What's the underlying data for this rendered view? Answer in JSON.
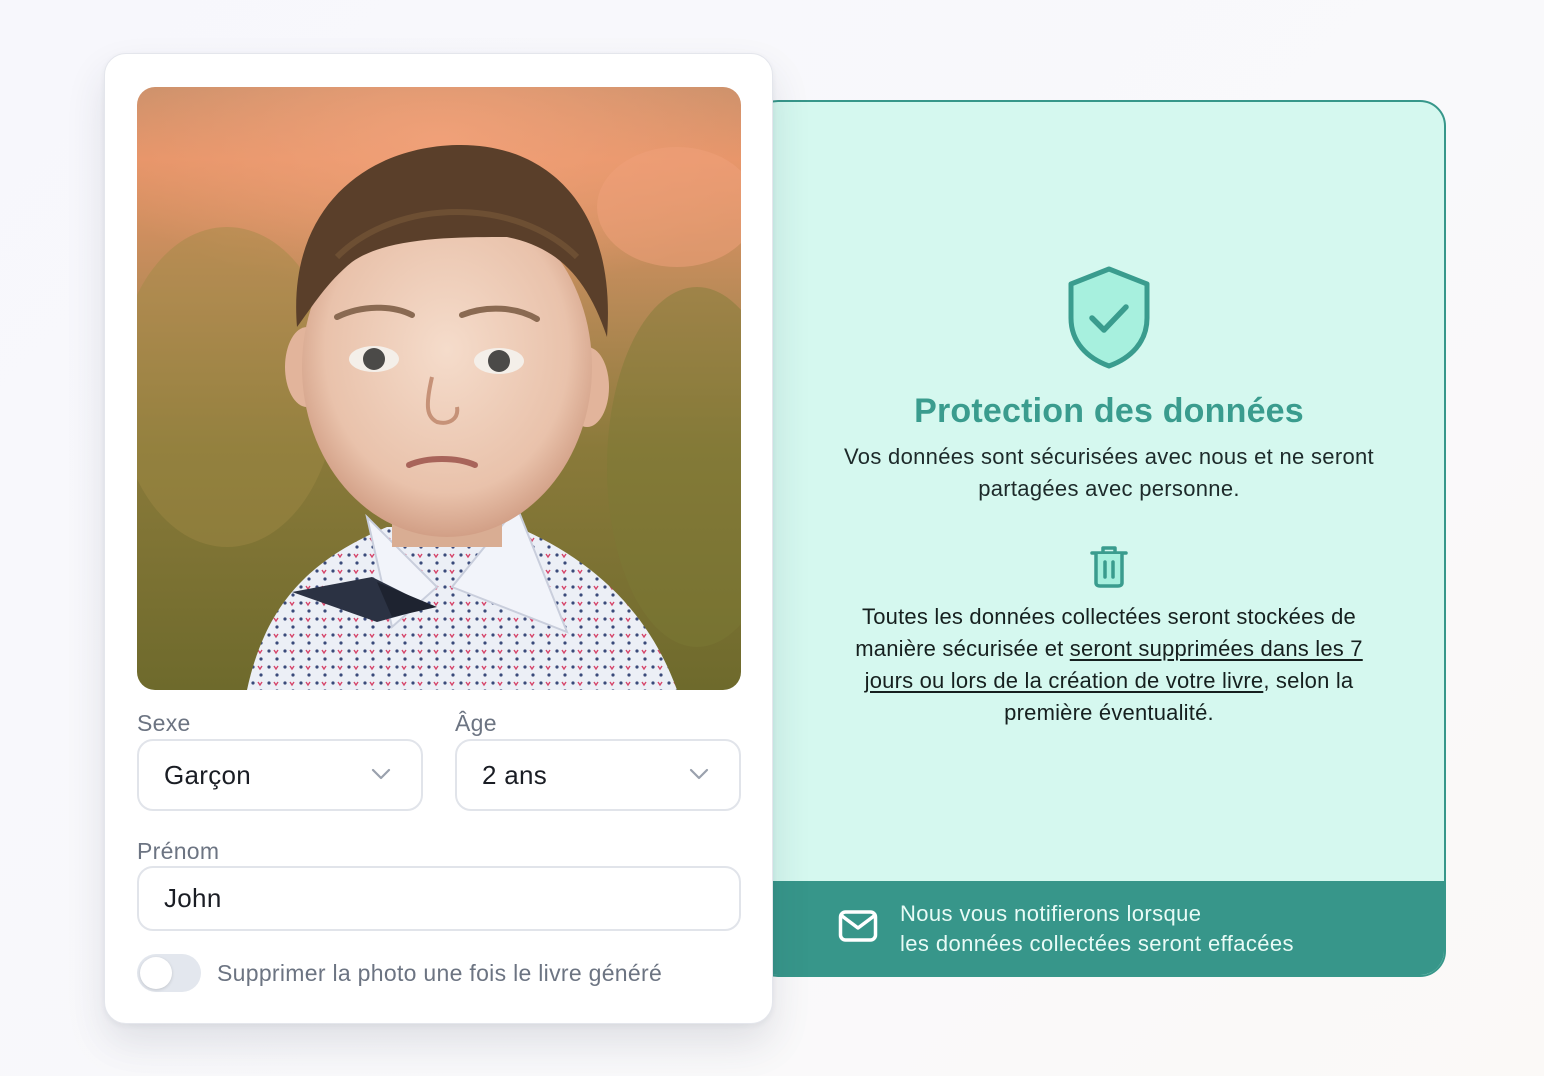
{
  "form": {
    "gender": {
      "label": "Sexe",
      "value": "Garçon"
    },
    "age": {
      "label": "Âge",
      "value": "2 ans"
    },
    "first_name": {
      "label": "Prénom",
      "value": "John"
    },
    "delete_photo_toggle": {
      "label": "Supprimer la photo une fois le livre généré",
      "checked": false
    }
  },
  "protection": {
    "title": "Protection des données",
    "description": "Vos données sont sécurisées avec nous et ne seront partagées avec personne.",
    "deletion_text_before": "Toutes les données collectées seront stockées de manière sécurisée et ",
    "deletion_text_link": "seront supprimées dans les 7 jours ou lors de la création de votre livre",
    "deletion_text_after": ", selon la première éventualité.",
    "notify_line1": "Nous vous notifierons lorsque",
    "notify_line2": "les données collectées seront effacées"
  },
  "icons": {
    "shield": "shield-check-icon",
    "trash": "trash-icon",
    "mail": "mail-icon",
    "chevron": "chevron-down-icon"
  },
  "colors": {
    "accent": "#37968a",
    "panel_bg": "#d5f8ef",
    "title": "#3a9c8e"
  }
}
